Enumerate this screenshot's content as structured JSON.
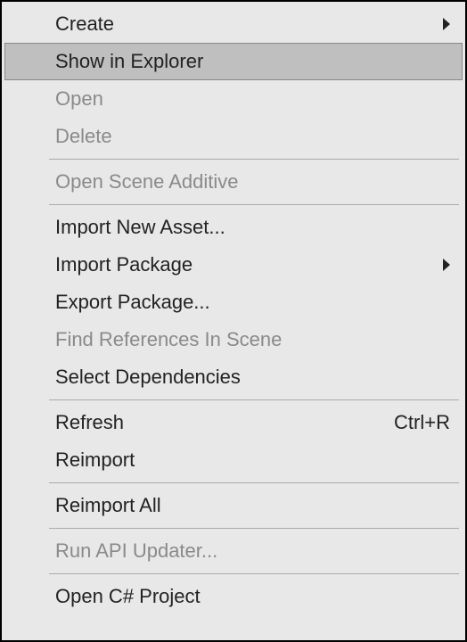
{
  "menu": {
    "items": [
      {
        "label": "Create",
        "has_submenu": true,
        "disabled": false,
        "highlight": false
      },
      {
        "label": "Show in Explorer",
        "has_submenu": false,
        "disabled": false,
        "highlight": true
      },
      {
        "label": "Open",
        "has_submenu": false,
        "disabled": true,
        "highlight": false
      },
      {
        "label": "Delete",
        "has_submenu": false,
        "disabled": true,
        "highlight": false
      },
      {
        "label": "Open Scene Additive",
        "has_submenu": false,
        "disabled": true,
        "highlight": false
      },
      {
        "label": "Import New Asset...",
        "has_submenu": false,
        "disabled": false,
        "highlight": false
      },
      {
        "label": "Import Package",
        "has_submenu": true,
        "disabled": false,
        "highlight": false
      },
      {
        "label": "Export Package...",
        "has_submenu": false,
        "disabled": false,
        "highlight": false
      },
      {
        "label": "Find References In Scene",
        "has_submenu": false,
        "disabled": true,
        "highlight": false
      },
      {
        "label": "Select Dependencies",
        "has_submenu": false,
        "disabled": false,
        "highlight": false
      },
      {
        "label": "Refresh",
        "has_submenu": false,
        "disabled": false,
        "highlight": false,
        "shortcut": "Ctrl+R"
      },
      {
        "label": "Reimport",
        "has_submenu": false,
        "disabled": false,
        "highlight": false
      },
      {
        "label": "Reimport All",
        "has_submenu": false,
        "disabled": false,
        "highlight": false
      },
      {
        "label": "Run API Updater...",
        "has_submenu": false,
        "disabled": true,
        "highlight": false
      },
      {
        "label": "Open C# Project",
        "has_submenu": false,
        "disabled": false,
        "highlight": false
      }
    ]
  }
}
